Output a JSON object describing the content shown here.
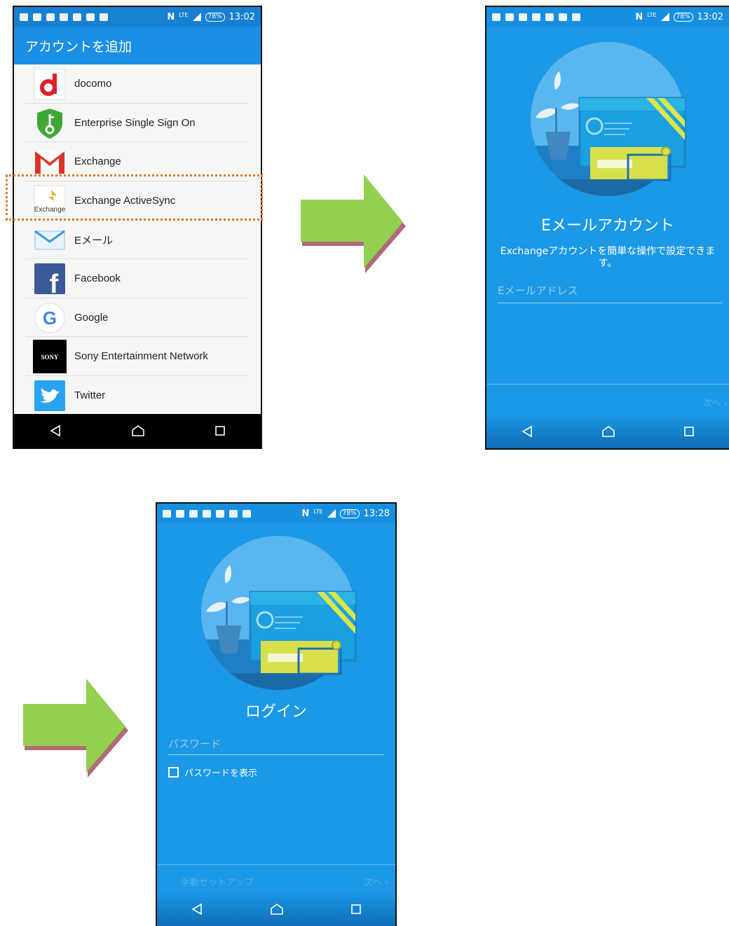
{
  "screen1": {
    "status": {
      "battery": "78%",
      "time": "13:02",
      "network": "LTE"
    },
    "title": "アカウントを追加",
    "items": [
      {
        "label": "docomo",
        "icon": "docomo-icon"
      },
      {
        "label": "Enterprise Single Sign On",
        "icon": "shield-key-icon"
      },
      {
        "label": "Exchange",
        "icon": "gmail-icon"
      },
      {
        "label": "Exchange ActiveSync",
        "icon": "exchange-activesync-icon",
        "icon_text": "Exchange",
        "highlighted": true
      },
      {
        "label": "Eメール",
        "icon": "mail-envelope-icon"
      },
      {
        "label": "Facebook",
        "icon": "facebook-icon",
        "icon_text": "f"
      },
      {
        "label": "Google",
        "icon": "google-icon",
        "icon_text": "G"
      },
      {
        "label": "Sony Entertainment Network",
        "icon": "sony-icon",
        "icon_text": "SONY"
      },
      {
        "label": "Twitter",
        "icon": "twitter-icon"
      }
    ]
  },
  "screen2": {
    "status": {
      "battery": "78%",
      "time": "13:02",
      "network": "LTE"
    },
    "title": "Eメールアカウント",
    "description": "Exchangeアカウントを簡単な操作で設定できます。",
    "email_placeholder": "Eメールアドレス",
    "next_label": "次へ ›"
  },
  "screen3": {
    "status": {
      "battery": "78%",
      "time": "13:28",
      "network": "LTE"
    },
    "title": "ログイン",
    "password_placeholder": "パスワード",
    "show_password_label": "パスワードを表示",
    "manual_setup_label": "手動セットアップ",
    "next_label": "次へ ›"
  },
  "colors": {
    "blue": "#1b98e6",
    "highlight": "#e07a2a",
    "arrow": "#92d050"
  }
}
